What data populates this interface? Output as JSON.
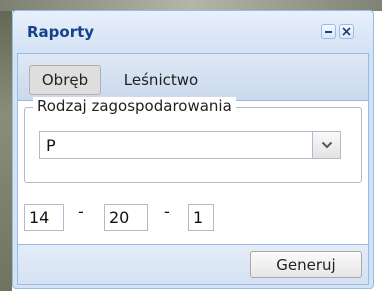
{
  "window": {
    "title": "Raporty",
    "minimize_icon": "minimize-icon",
    "close_icon": "close-icon"
  },
  "tabs": [
    {
      "label": "Obręb",
      "active": true
    },
    {
      "label": "Leśnictwo",
      "active": false
    }
  ],
  "land_use": {
    "legend": "Rodzaj zagospodarowania",
    "selected": "P",
    "trigger_icon": "chevron-down-icon"
  },
  "fields": {
    "part1": "14",
    "separator1": "-",
    "part2": "20",
    "separator2": "-",
    "part3": "1"
  },
  "footer": {
    "generate_label": "Generuj"
  }
}
